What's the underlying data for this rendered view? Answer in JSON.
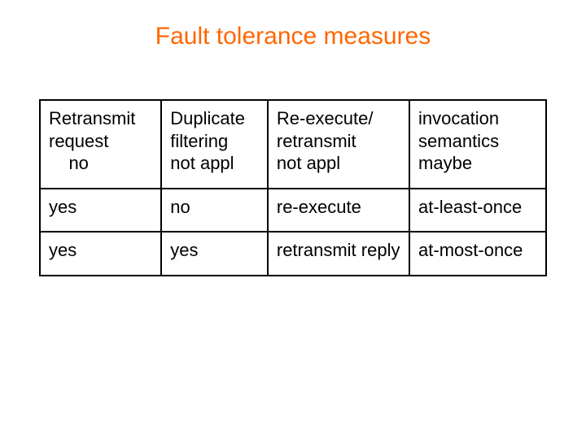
{
  "title": "Fault tolerance measures",
  "hdr": {
    "c1a": "Retransmit",
    "c1b": "request",
    "c1c": "    no",
    "c2a": "Duplicate",
    "c2b": "filtering",
    "c2c": "not appl",
    "c3a": "Re-execute/",
    "c3b": "retransmit",
    "c3c": "not appl",
    "c4a": "invocation",
    "c4b": "semantics",
    "c4c": "maybe"
  },
  "rows": [
    {
      "r": "yes",
      "d": "no",
      "e": "re-execute",
      "s": "at-least-once"
    },
    {
      "r": "yes",
      "d": "yes",
      "e": "retransmit reply",
      "s": "at-most-once"
    }
  ],
  "chart_data": {
    "type": "table",
    "title": "Fault tolerance measures",
    "columns": [
      "Retransmit request",
      "Duplicate filtering",
      "Re-execute/retransmit",
      "invocation semantics"
    ],
    "rows": [
      [
        "no",
        "not appl",
        "not appl",
        "maybe"
      ],
      [
        "yes",
        "no",
        "re-execute",
        "at-least-once"
      ],
      [
        "yes",
        "yes",
        "retransmit reply",
        "at-most-once"
      ]
    ]
  }
}
